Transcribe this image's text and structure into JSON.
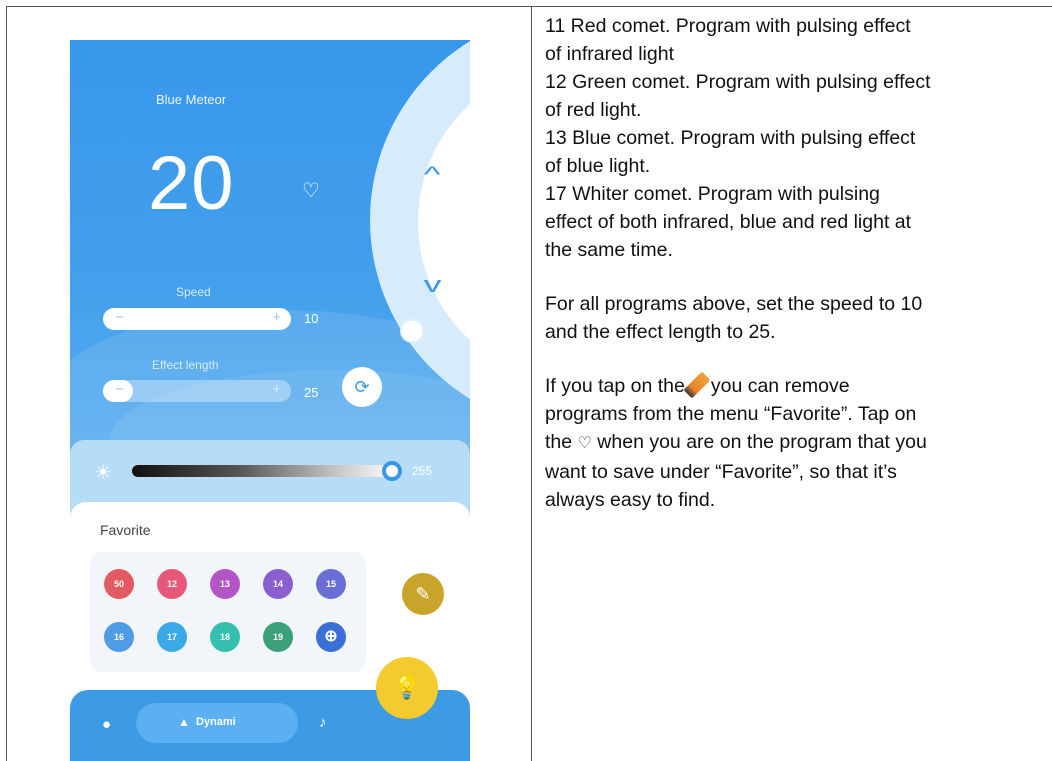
{
  "phone": {
    "program_name": "Blue Meteor",
    "program_number": "20",
    "speed_label": "Speed",
    "speed_value": "10",
    "effect_length_label": "Effect length",
    "effect_length_value": "25",
    "brightness_value": "255",
    "favorite_title": "Favorite",
    "favorites": [
      {
        "label": "50",
        "color": "#e45a63"
      },
      {
        "label": "12",
        "color": "#e8587b"
      },
      {
        "label": "13",
        "color": "#b455c5"
      },
      {
        "label": "14",
        "color": "#8a5fcf"
      },
      {
        "label": "15",
        "color": "#6a6fd6"
      },
      {
        "label": "16",
        "color": "#4f9be5"
      },
      {
        "label": "17",
        "color": "#3aa9e8"
      },
      {
        "label": "18",
        "color": "#35bfae"
      },
      {
        "label": "19",
        "color": "#3aa07a"
      }
    ],
    "nav_dynamic_label": "Dynami",
    "colors": {
      "primary": "#3d9be6",
      "edit_button": "#c9a42a",
      "bulb_button": "#f4cb2e"
    },
    "icons": [
      "heart-icon",
      "chevron-up-icon",
      "chevron-down-icon",
      "sync-icon",
      "sun-icon",
      "pencil-icon",
      "add-favorite-icon",
      "palette-icon",
      "shapes-icon",
      "music-icon",
      "bulb-icon"
    ]
  },
  "instructions": {
    "line1": "11 Red comet. Program with pulsing effect",
    "line2": "of infrared light",
    "line3": "12 Green comet. Program with pulsing effect",
    "line4": "of red light.",
    "line5": "13 Blue comet. Program with pulsing effect",
    "line6": "of blue light.",
    "line7": "17 Whiter comet. Program with pulsing",
    "line8": "effect of both infrared, blue and red light at",
    "line9": "the same time.",
    "line10": "For all programs above, set the speed to 10",
    "line11": "and the effect length to 25.",
    "line12a": "If you tap on the",
    "line12b": "you can remove",
    "line13": "programs from the menu “Favorite”. Tap on",
    "line14a": "the",
    "line14b": "when you are on the program that you",
    "line15": "want to save under “Favorite”, so that it’s",
    "line16": "always easy to find."
  }
}
